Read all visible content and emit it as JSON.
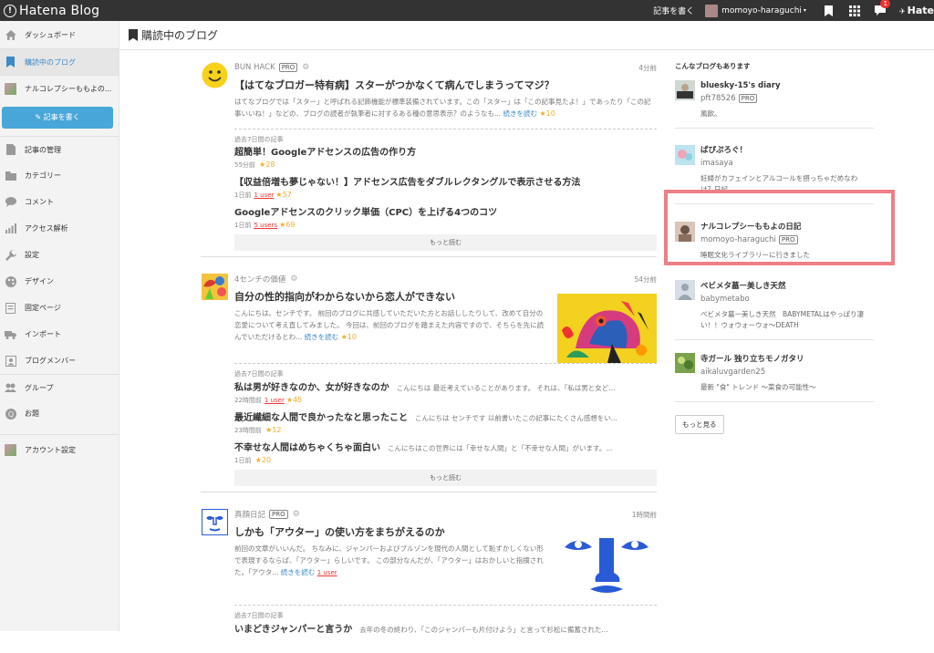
{
  "topbar": {
    "brand": "Hatena Blog",
    "write_label": "記事を書く",
    "username": "momoyo-haraguchi",
    "notif_count": "1",
    "hatena": "Hate"
  },
  "sidebar": {
    "items": [
      {
        "label": "ダッシュボード",
        "icon": "home-icon"
      },
      {
        "label": "購読中のブログ",
        "icon": "bookmark-icon"
      },
      {
        "label": "ナルコレプシーももよの...",
        "icon": "blog-avatar"
      },
      {
        "label": "記事の管理",
        "icon": "document-icon"
      },
      {
        "label": "カテゴリー",
        "icon": "folder-icon"
      },
      {
        "label": "コメント",
        "icon": "comment-icon"
      },
      {
        "label": "アクセス解析",
        "icon": "chart-icon"
      },
      {
        "label": "設定",
        "icon": "wrench-icon"
      },
      {
        "label": "デザイン",
        "icon": "palette-icon"
      },
      {
        "label": "固定ページ",
        "icon": "page-icon"
      },
      {
        "label": "インポート",
        "icon": "truck-icon"
      },
      {
        "label": "ブログメンバー",
        "icon": "members-icon"
      },
      {
        "label": "グループ",
        "icon": "group-icon"
      },
      {
        "label": "お題",
        "icon": "question-icon"
      },
      {
        "label": "アカウント設定",
        "icon": "account-avatar"
      }
    ],
    "write_button": "記事を書く"
  },
  "page": {
    "title": "購読中のブログ"
  },
  "feed": {
    "recent_label": "過去7日間の記事",
    "more_label": "もっと読む",
    "entries": [
      {
        "blog": "BUN HACK",
        "pro": "PRO",
        "time": "4分前",
        "title": "【はてなブロガー特有病】スターがつかなくて病んでしまうってマジ？",
        "summary": "はてなブログでは「スター」と呼ばれる記飾機能が標準装備されています。この「スター」は「この記事見たよ！」であったり「この記事いいね！」などの、ブログの読者が執筆者に対するある種の意思表示？のようなも...",
        "more": "続きを読む",
        "stars": "★10",
        "recent": [
          {
            "title": "超簡単！Googleアドセンスの広告の作り方",
            "snippet": "",
            "time": "55分前",
            "users": "",
            "stars": "★28"
          },
          {
            "title": "【収益倍増も夢じゃない！】アドセンス広告をダブルレクタングルで表示させる方法",
            "snippet": "",
            "time": "1日前",
            "users": "1 user",
            "stars": "★57"
          },
          {
            "title": "Googleアドセンスのクリック単価（CPC）を上げる4つのコツ",
            "snippet": "",
            "time": "1日前",
            "users": "5 users",
            "stars": "★69"
          }
        ]
      },
      {
        "blog": "4センチの価値",
        "pro": "",
        "time": "54分前",
        "title": "自分の性的指向がわからないから恋人ができない",
        "summary": "こんにちは。センチです。 前回のブログに共感していただいた方とお話ししたりして、改めて自分の恋愛について考え直してみました。 今回は、前回のブログを踏まえた内容ですので、そちらを先に読んでいただけるとわ...",
        "more": "続きを読む",
        "stars": "★10",
        "recent": [
          {
            "title": "私は男が好きなのか、女が好きなのか",
            "snippet": "こんにちは 最近考えていることがあります。 それは、「私は男と女ど...",
            "time": "22時間前",
            "users": "1 user",
            "stars": "★45"
          },
          {
            "title": "最近繊細な人間で良かったなと思ったこと",
            "snippet": "こんにちは センチです 以前書いたこの記事にたくさん感想をい...",
            "time": "23時間前",
            "users": "",
            "stars": "★12"
          },
          {
            "title": "不幸せな人間はめちゃくちゃ面白い",
            "snippet": "こんにちはこの世界には「幸せな人間」と「不幸せな人間」がいます。...",
            "time": "1日前",
            "users": "",
            "stars": "★20"
          }
        ]
      },
      {
        "blog": "真顔日記",
        "pro": "PRO",
        "time": "1時間前",
        "title": "しかも「アウター」の使い方をまちがえるのか",
        "summary": "前回の文章がいいんだ。 ちなみに、ジャンパーおよびブルゾンを現代の人間として恥ずかしくない形で表現するならば、「アウター」らしいです。 この部分なんだが、「アウター」はおかしいと指摘された。「アウタ...",
        "more": "続きを読む",
        "users": "1 user",
        "recent": [
          {
            "title": "いまどきジャンパーと言うか",
            "snippet": "去年の冬の終わり、「このジャンパーも片付けよう」と言って杉松に備蓄された..."
          }
        ]
      }
    ]
  },
  "right": {
    "title": "こんなブログもあります",
    "suggestions": [
      {
        "name": "bluesky-15's diary",
        "user": "pft78526",
        "pro": "PRO",
        "desc": "風飲。"
      },
      {
        "name": "ぱぴぷろぐ！",
        "user": "imasaya",
        "pro": "",
        "desc": "妊婦がカフェインとアルコールを摂っちゃだめなわけ？日記"
      },
      {
        "name": "ナルコレプシーももよの日記",
        "user": "momoyo-haraguchi",
        "pro": "PRO",
        "desc": "睡眠文化ライブラリーに行きました"
      },
      {
        "name": "ベビメタ墓ー美しき天然",
        "user": "babymetabo",
        "pro": "",
        "desc": "ベビメタ墓ー美しき天然　BABYMETALはやっぱり凄い！！ウォウォーウォ〜DEATH"
      },
      {
        "name": "寺ガール 独り立ちモノガタリ",
        "user": "aikaluvgarden25",
        "pro": "",
        "desc": "最新 \"食\" トレンド 〜菜食の可能性〜"
      }
    ],
    "more_button": "もっと見る"
  },
  "colors": {
    "accent": "#49a6d8",
    "star": "#f0ad28",
    "highlight": "#ef7f86",
    "users": "#e33333"
  }
}
